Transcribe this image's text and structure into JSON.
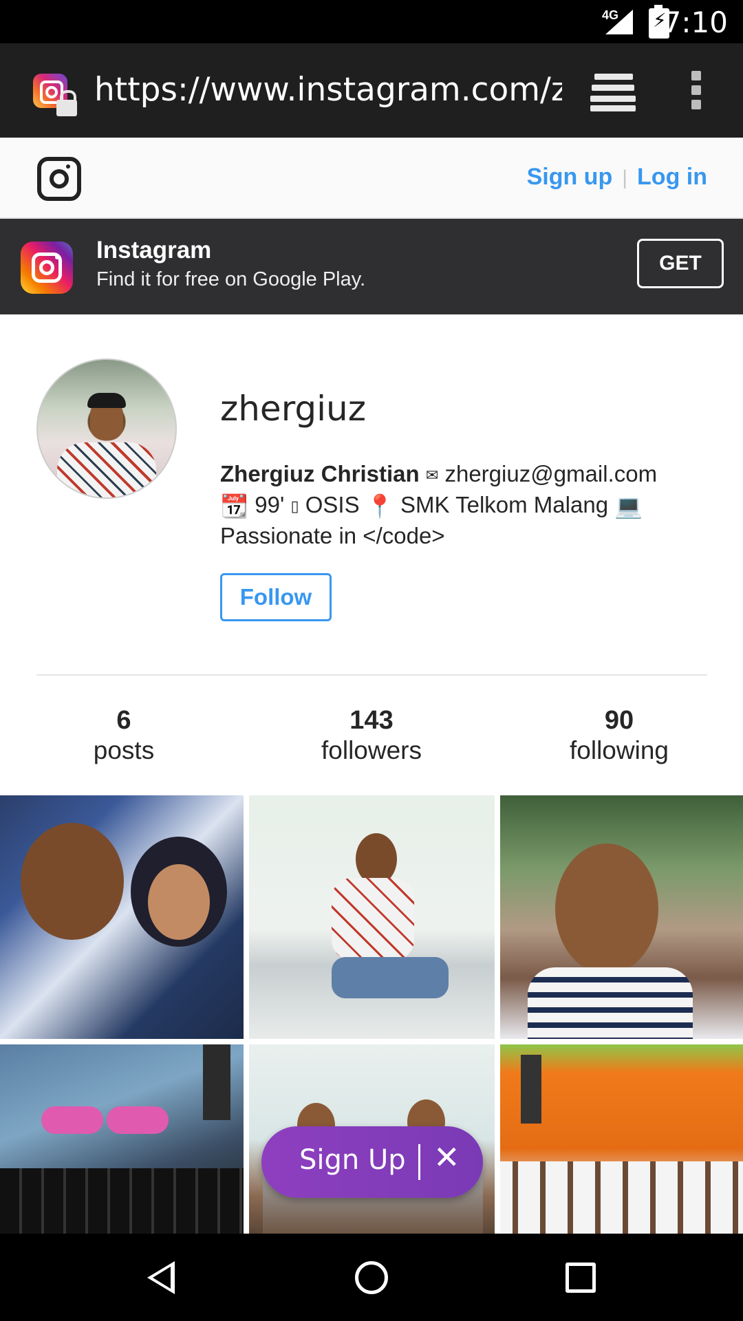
{
  "status_bar": {
    "network": "4G",
    "time": "7:10"
  },
  "browser": {
    "url": "https://www.instagram.com/zhe"
  },
  "header": {
    "signup_label": "Sign up",
    "separator": "|",
    "login_label": "Log in"
  },
  "app_banner": {
    "title": "Instagram",
    "subtitle": "Find it for free on Google Play.",
    "get_label": "GET"
  },
  "profile": {
    "username": "zhergiuz",
    "display_name": "Zhergiuz Christian",
    "bio_line1_icon": "✉",
    "email": "zhergiuz@gmail.com",
    "bio_line2_calendar": "📆",
    "bio_line2_year": "99'",
    "bio_line2_osis": "OSIS",
    "bio_line2_pin": "📍",
    "bio_line2_school": "SMK Telkom Malang",
    "bio_line2_pc": "💻",
    "bio_line3": "Passionate in </code>",
    "follow_label": "Follow"
  },
  "stats": {
    "posts": {
      "value": "6",
      "label": "posts"
    },
    "followers": {
      "value": "143",
      "label": "followers"
    },
    "following": {
      "value": "90",
      "label": "following"
    }
  },
  "signup_pill": {
    "label": "Sign Up",
    "close": "✕"
  },
  "colors": {
    "link_blue": "#3897f0",
    "pill_purple": "#8e3fbf",
    "banner_bg": "#2f2f31"
  },
  "icons": [
    "instagram-favicon-icon",
    "lock-icon",
    "tabs-icon",
    "overflow-menu-icon",
    "instagram-logo-icon",
    "instagram-app-icon",
    "back-icon",
    "home-icon",
    "recents-icon"
  ]
}
